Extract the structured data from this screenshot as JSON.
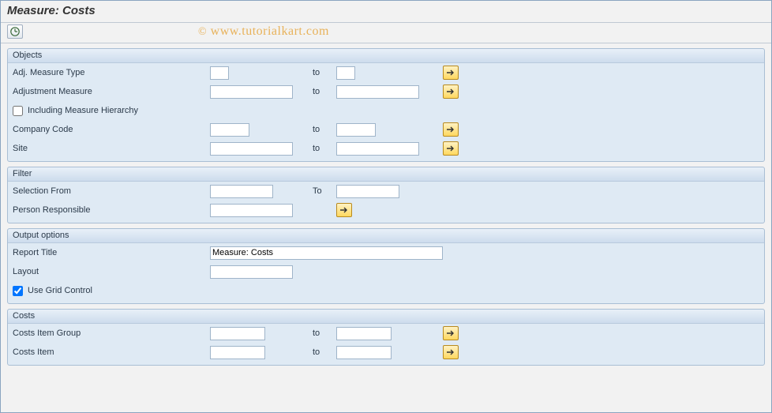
{
  "title": "Measure: Costs",
  "watermark": "www.tutorialkart.com",
  "watermark_copy": "©",
  "groups": {
    "objects": {
      "header": "Objects",
      "adj_measure_type_label": "Adj. Measure Type",
      "adjustment_measure_label": "Adjustment Measure",
      "including_hierarchy_label": "Including Measure Hierarchy",
      "including_hierarchy_checked": false,
      "company_code_label": "Company Code",
      "site_label": "Site",
      "to_label": "to"
    },
    "filter": {
      "header": "Filter",
      "selection_from_label": "Selection From",
      "to_label": "To",
      "person_responsible_label": "Person Responsible"
    },
    "output": {
      "header": "Output options",
      "report_title_label": "Report Title",
      "report_title_value": "Measure: Costs",
      "layout_label": "Layout",
      "use_grid_label": "Use Grid Control",
      "use_grid_checked": true
    },
    "costs": {
      "header": "Costs",
      "costs_item_group_label": "Costs Item Group",
      "costs_item_label": "Costs Item",
      "to_label": "to"
    }
  }
}
